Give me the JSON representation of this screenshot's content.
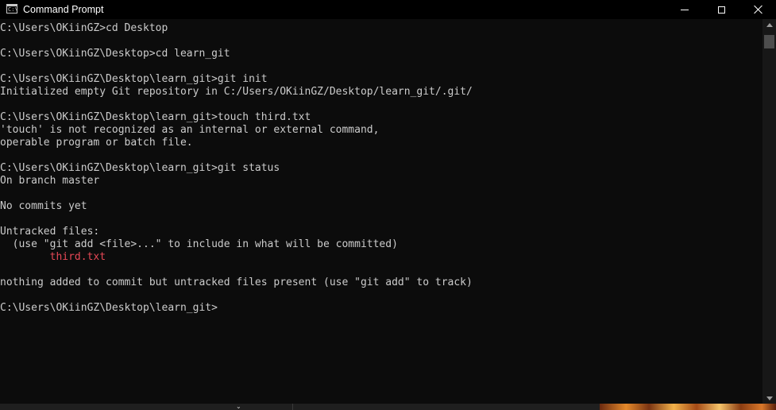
{
  "window": {
    "title": "Command Prompt",
    "app_icon_text": "C:\\"
  },
  "console": {
    "lines": [
      {
        "text": "C:\\Users\\OKiinGZ>cd Desktop"
      },
      {
        "text": ""
      },
      {
        "text": "C:\\Users\\OKiinGZ\\Desktop>cd learn_git"
      },
      {
        "text": ""
      },
      {
        "text": "C:\\Users\\OKiinGZ\\Desktop\\learn_git>git init"
      },
      {
        "text": "Initialized empty Git repository in C:/Users/OKiinGZ/Desktop/learn_git/.git/"
      },
      {
        "text": ""
      },
      {
        "text": "C:\\Users\\OKiinGZ\\Desktop\\learn_git>touch third.txt"
      },
      {
        "text": "'touch' is not recognized as an internal or external command,"
      },
      {
        "text": "operable program or batch file."
      },
      {
        "text": ""
      },
      {
        "text": "C:\\Users\\OKiinGZ\\Desktop\\learn_git>git status"
      },
      {
        "text": "On branch master"
      },
      {
        "text": ""
      },
      {
        "text": "No commits yet"
      },
      {
        "text": ""
      },
      {
        "text": "Untracked files:"
      },
      {
        "text": "  (use \"git add <file>...\" to include in what will be committed)"
      },
      {
        "text": "        third.txt",
        "style": "untracked"
      },
      {
        "text": ""
      },
      {
        "text": "nothing added to commit but untracked files present (use \"git add\" to track)"
      },
      {
        "text": ""
      },
      {
        "text": "C:\\Users\\OKiinGZ\\Desktop\\learn_git>"
      }
    ]
  },
  "taskbar": {
    "chevron": "⌄"
  },
  "colors": {
    "background": "#0c0c0c",
    "foreground": "#cccccc",
    "untracked": "#e74856",
    "titlebar": "#000000"
  },
  "icons": [
    "console-app-icon",
    "minimize-icon",
    "maximize-icon",
    "close-icon",
    "scroll-up-arrow-icon",
    "scroll-down-arrow-icon",
    "chevron-down-icon"
  ]
}
